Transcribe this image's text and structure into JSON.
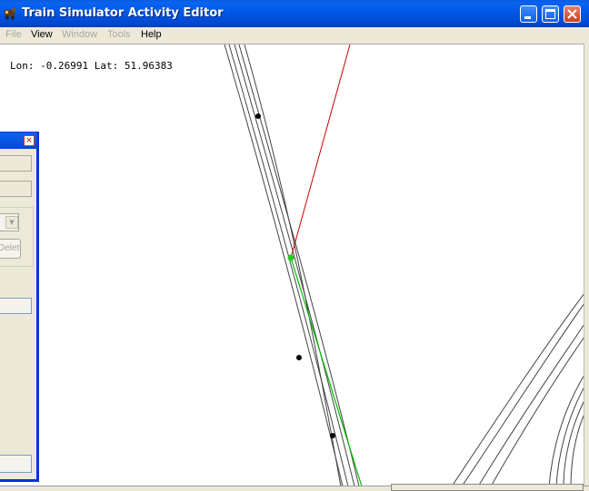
{
  "window": {
    "title": "Train Simulator Activity Editor"
  },
  "menu": [
    {
      "label": "File",
      "enabled": false
    },
    {
      "label": "View",
      "enabled": true
    },
    {
      "label": "Window",
      "enabled": false
    },
    {
      "label": "Tools",
      "enabled": false
    },
    {
      "label": "Help",
      "enabled": true
    }
  ],
  "map": {
    "coordinates": "Lon: -0.26991 Lat: 51.96383",
    "colors": {
      "track": "#444444",
      "selected_path": "#00bb00",
      "link_line": "#cc0000",
      "node": "#000000",
      "selected_node": "#22cc22"
    }
  },
  "dialog": {
    "close_label": "×",
    "combo_arrow": "▼",
    "delete_label": "Delete"
  },
  "icons": {
    "app": "train-icon",
    "minimize": "minimize-icon",
    "maximize": "maximize-icon",
    "close": "close-icon"
  }
}
